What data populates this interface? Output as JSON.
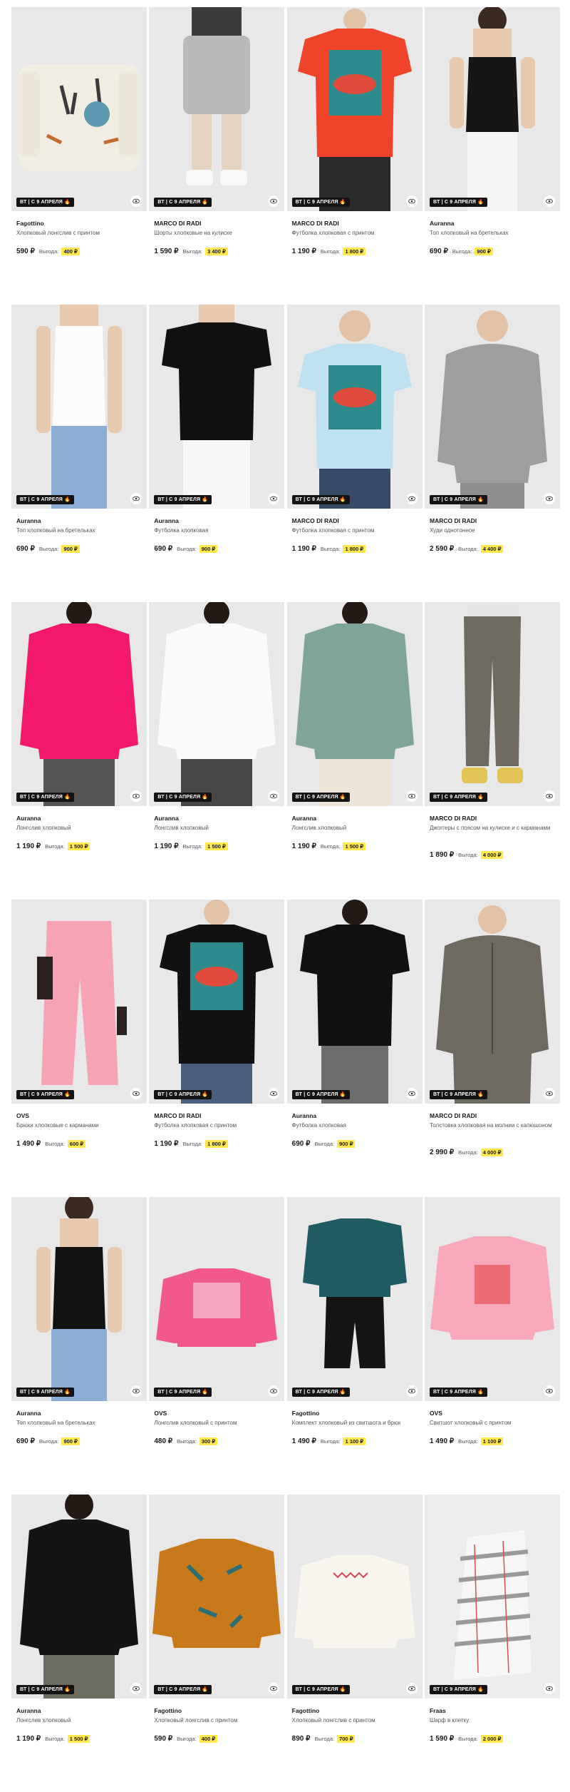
{
  "badge_text": "ВТ | С 9 АПРЕЛЯ",
  "benefit_label": "Выгода:",
  "eye_icon": "eye-icon",
  "colors": {
    "badge_bg": "#141414",
    "save_bg": "#ffe94d",
    "photo_bg": "#e8e8e8"
  },
  "products": [
    {
      "brand": "Fagottino",
      "name": "Хлопковый лонгслив с принтом",
      "price": "590 ₽",
      "saving": "400 ₽"
    },
    {
      "brand": "MARCO DI RADI",
      "name": "Шорты хлопковые на кулиске",
      "price": "1 590 ₽",
      "saving": "3 400 ₽"
    },
    {
      "brand": "MARCO DI RADI",
      "name": "Футболка хлопковая с принтом",
      "price": "1 190 ₽",
      "saving": "1 800 ₽"
    },
    {
      "brand": "Auranna",
      "name": "Топ хлопковый на бретельках",
      "price": "690 ₽",
      "saving": "900 ₽"
    },
    {
      "brand": "Auranna",
      "name": "Топ хлопковый на бретельках",
      "price": "690 ₽",
      "saving": "900 ₽"
    },
    {
      "brand": "Auranna",
      "name": "Футболка хлопковая",
      "price": "690 ₽",
      "saving": "900 ₽"
    },
    {
      "brand": "MARCO DI RADI",
      "name": "Футболка хлопковая с принтом",
      "price": "1 190 ₽",
      "saving": "1 800 ₽"
    },
    {
      "brand": "MARCO DI RADI",
      "name": "Худи однотонное",
      "price": "2 590 ₽",
      "saving": "4 400 ₽"
    },
    {
      "brand": "Auranna",
      "name": "Лонгслив хлопковый",
      "price": "1 190 ₽",
      "saving": "1 500 ₽"
    },
    {
      "brand": "Auranna",
      "name": "Лонгслив хлопковый",
      "price": "1 190 ₽",
      "saving": "1 500 ₽"
    },
    {
      "brand": "Auranna",
      "name": "Лонгслив хлопковый",
      "price": "1 190 ₽",
      "saving": "1 500 ₽"
    },
    {
      "brand": "MARCO DI RADI",
      "name": "Джоггеры с поясом на кулиске и с карманами",
      "price": "1 890 ₽",
      "saving": "4 000 ₽"
    },
    {
      "brand": "OVS",
      "name": "Брюки хлопковые с карманами",
      "price": "1 490 ₽",
      "saving": "600 ₽"
    },
    {
      "brand": "MARCO DI RADI",
      "name": "Футболка хлопковая с принтом",
      "price": "1 190 ₽",
      "saving": "1 800 ₽"
    },
    {
      "brand": "Auranna",
      "name": "Футболка хлопковая",
      "price": "690 ₽",
      "saving": "900 ₽"
    },
    {
      "brand": "MARCO DI RADI",
      "name": "Толстовка хлопковая на молнии с капюшоном",
      "price": "2 990 ₽",
      "saving": "4 000 ₽"
    },
    {
      "brand": "Auranna",
      "name": "Топ хлопковый на бретельках",
      "price": "690 ₽",
      "saving": "900 ₽"
    },
    {
      "brand": "OVS",
      "name": "Лонгслив хлопковый с принтом",
      "price": "480 ₽",
      "saving": "300 ₽"
    },
    {
      "brand": "Fagottino",
      "name": "Комплект хлопковый из свитшота и брюк",
      "price": "1 490 ₽",
      "saving": "1 100 ₽"
    },
    {
      "brand": "OVS",
      "name": "Свитшот хлопковый с принтом",
      "price": "1 490 ₽",
      "saving": "1 100 ₽"
    },
    {
      "brand": "Auranna",
      "name": "Лонгслив хлопковый",
      "price": "1 190 ₽",
      "saving": "1 500 ₽"
    },
    {
      "brand": "Fagottino",
      "name": "Хлопковый лонгслив с принтом",
      "price": "590 ₽",
      "saving": "400 ₽"
    },
    {
      "brand": "Fagottino",
      "name": "Хлопковый лонгслив с принтом",
      "price": "890 ₽",
      "saving": "700 ₽"
    },
    {
      "brand": "Fraas",
      "name": "Шарф в клетку",
      "price": "1 590 ₽",
      "saving": "2 000 ₽"
    }
  ]
}
